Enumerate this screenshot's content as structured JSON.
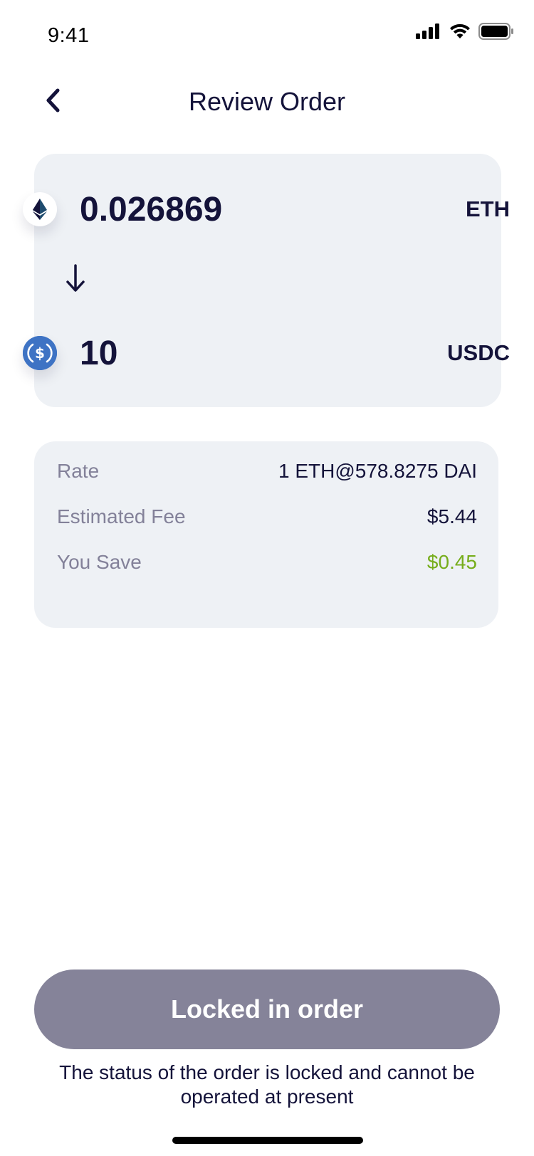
{
  "status_bar": {
    "time": "9:41"
  },
  "nav": {
    "title": "Review Order"
  },
  "swap": {
    "from": {
      "amount": "0.026869",
      "symbol": "ETH",
      "icon": "eth-icon"
    },
    "to": {
      "amount": "10",
      "symbol": "USDC",
      "icon": "usdc-icon"
    }
  },
  "details": {
    "rate_label": "Rate",
    "rate_value": "1 ETH@578.8275 DAI",
    "fee_label": "Estimated Fee",
    "fee_value": "$5.44",
    "save_label": "You Save",
    "save_value": "$0.45"
  },
  "action": {
    "button_label": "Locked in order",
    "note": "The status of the order is locked and cannot be operated at present"
  },
  "colors": {
    "text": "#14133a",
    "card": "#eef1f5",
    "muted": "#838199",
    "positive": "#76ad1b",
    "button_disabled": "#858399",
    "usdc": "#3e73c4"
  }
}
